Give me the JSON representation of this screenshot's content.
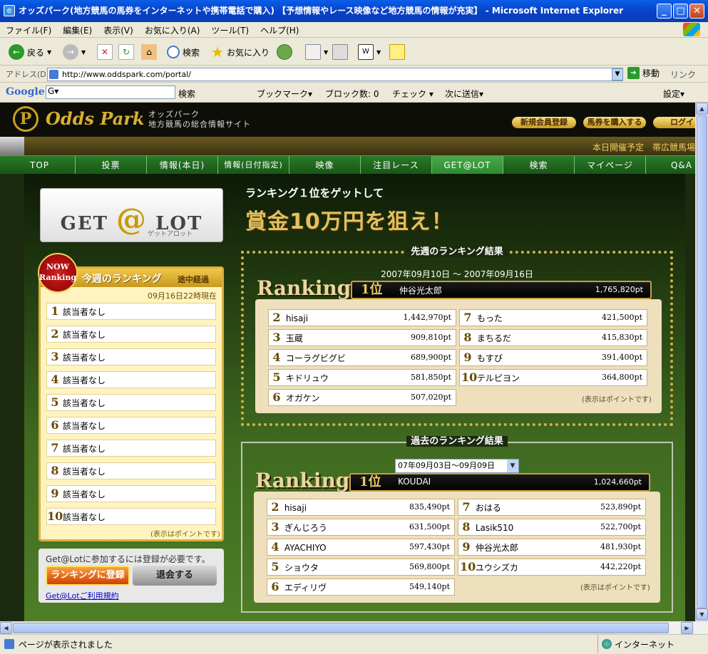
{
  "window": {
    "title": "オッズパーク(地方競馬の馬券をインターネットや携帯電話で購入) 【予想情報やレース映像など地方競馬の情報が充実】 - Microsoft Internet Explorer"
  },
  "menu": [
    "ファイル(F)",
    "編集(E)",
    "表示(V)",
    "お気に入り(A)",
    "ツール(T)",
    "ヘルプ(H)"
  ],
  "toolbar": {
    "back": "戻る",
    "search": "検索",
    "favorites": "お気に入り"
  },
  "address": {
    "label": "アドレス(D)",
    "url": "http://www.oddspark.com/portal/",
    "go": "移動",
    "links": "リンク"
  },
  "google": {
    "logo": "Google",
    "input": "G▾",
    "search": "検索",
    "bookmarks": "ブックマーク▾",
    "blocked": "ブロック数: 0",
    "check": "チェック ▾",
    "sendto": "次に送信▾",
    "settings": "設定▾"
  },
  "site": {
    "logo_letter": "P",
    "logo_text": "Odds Park",
    "logo_sub1": "オッズパーク",
    "logo_sub2": "地方競馬の総合情報サイト",
    "header_buttons": [
      "新規会員登録",
      "馬券を購入する",
      "ログイ"
    ],
    "info_text": "本日開催予定　帯広競馬場",
    "nav": [
      "TOP",
      "投票",
      "情報(本日)",
      "情報(日付指定)",
      "映像",
      "注目レース",
      "GET@LOT",
      "検索",
      "マイページ",
      "Q&A"
    ],
    "getlot": {
      "left": "GET",
      "at": "@",
      "right": "LOT",
      "sub": "ゲットアロット"
    },
    "weekly": {
      "badge1": "NOW",
      "badge2": "Ranking",
      "title": "今週のランキング",
      "sub": "途中経過",
      "time": "09月16日22時現在",
      "rows": [
        {
          "n": "1",
          "t": "該当者なし"
        },
        {
          "n": "2",
          "t": "該当者なし"
        },
        {
          "n": "3",
          "t": "該当者なし"
        },
        {
          "n": "4",
          "t": "該当者なし"
        },
        {
          "n": "5",
          "t": "該当者なし"
        },
        {
          "n": "6",
          "t": "該当者なし"
        },
        {
          "n": "7",
          "t": "該当者なし"
        },
        {
          "n": "8",
          "t": "該当者なし"
        },
        {
          "n": "9",
          "t": "該当者なし"
        },
        {
          "n": "10",
          "t": "該当者なし"
        }
      ],
      "note": "(表示はポイントです)"
    },
    "join": {
      "text": "Get@Lotに参加するには登録が必要です。",
      "register": "ランキングに登録",
      "leave": "退会する",
      "terms": "Get@Lotご利用規約"
    },
    "promo": {
      "line1": "ランキング１位をゲットして",
      "line2": "賞金10万円を狙え！"
    },
    "last": {
      "title": "先週のランキング結果",
      "period": "2007年09月10日 ～ 2007年09月16日",
      "ranking_word": "Ranking",
      "first": {
        "rank": "1位",
        "name": "仲谷光太郎",
        "pt": "1,765,820pt"
      },
      "left": [
        {
          "n": "2",
          "name": "hisaji",
          "pt": "1,442,970pt"
        },
        {
          "n": "3",
          "name": "玉蔵",
          "pt": "909,810pt"
        },
        {
          "n": "4",
          "name": "コーラグビグビ",
          "pt": "689,900pt"
        },
        {
          "n": "5",
          "name": "キドリュウ",
          "pt": "581,850pt"
        },
        {
          "n": "6",
          "name": "オガケン",
          "pt": "507,020pt"
        }
      ],
      "right": [
        {
          "n": "7",
          "name": "もった",
          "pt": "421,500pt"
        },
        {
          "n": "8",
          "name": "まちるだ",
          "pt": "415,830pt"
        },
        {
          "n": "9",
          "name": "もすび",
          "pt": "391,400pt"
        },
        {
          "n": "10",
          "name": "テルピヨン",
          "pt": "364,800pt"
        }
      ],
      "note": "(表示はポイントです)"
    },
    "past": {
      "title": "過去のランキング結果",
      "select": "07年09月03日～09月09日",
      "ranking_word": "Ranking",
      "first": {
        "rank": "1位",
        "name": "KOUDAI",
        "pt": "1,024,660pt"
      },
      "left": [
        {
          "n": "2",
          "name": "hisaji",
          "pt": "835,490pt"
        },
        {
          "n": "3",
          "name": "ぎんじろう",
          "pt": "631,500pt"
        },
        {
          "n": "4",
          "name": "AYACHIYO",
          "pt": "597,430pt"
        },
        {
          "n": "5",
          "name": "ショウタ",
          "pt": "569,800pt"
        },
        {
          "n": "6",
          "name": "エディリヴ",
          "pt": "549,140pt"
        }
      ],
      "right": [
        {
          "n": "7",
          "name": "おはる",
          "pt": "523,890pt"
        },
        {
          "n": "8",
          "name": "Lasik510",
          "pt": "522,700pt"
        },
        {
          "n": "9",
          "name": "仲谷光太郎",
          "pt": "481,930pt"
        },
        {
          "n": "10",
          "name": "ユウシズカ",
          "pt": "442,220pt"
        }
      ],
      "note": "(表示はポイントです)"
    }
  },
  "status": {
    "text": "ページが表示されました",
    "zone": "インターネット"
  }
}
